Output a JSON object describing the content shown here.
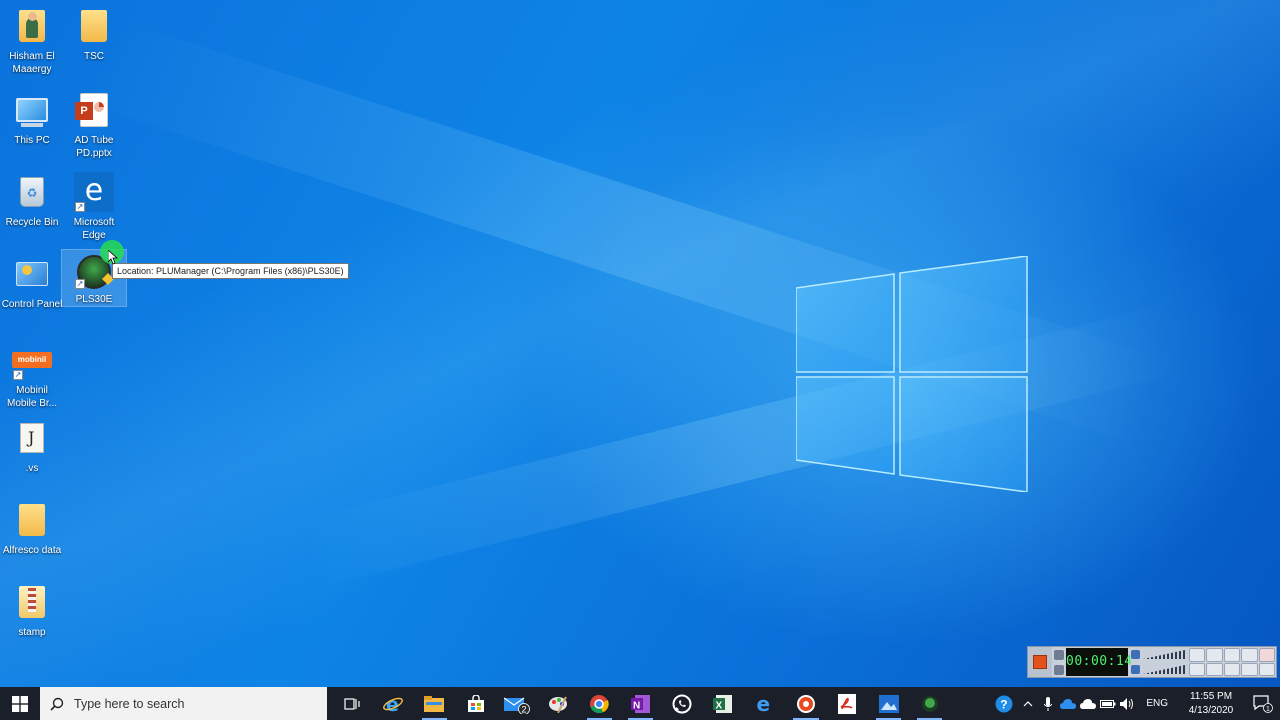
{
  "desktop": {
    "icons": [
      {
        "id": "hisham",
        "label": "Hisham El\nMaaergy",
        "icon": "user-folder-icon"
      },
      {
        "id": "tsc",
        "label": "TSC",
        "icon": "folder-icon"
      },
      {
        "id": "thispc",
        "label": "This PC",
        "icon": "computer-icon"
      },
      {
        "id": "adtube",
        "label": "AD Tube\nPD.pptx",
        "icon": "powerpoint-icon"
      },
      {
        "id": "recycle",
        "label": "Recycle Bin",
        "icon": "recycle-bin-icon"
      },
      {
        "id": "edge",
        "label": "Microsoft\nEdge",
        "icon": "edge-icon"
      },
      {
        "id": "control",
        "label": "Control Panel",
        "icon": "control-panel-icon"
      },
      {
        "id": "pls",
        "label": "PLS30E",
        "icon": "pls-app-icon"
      },
      {
        "id": "mobinil",
        "label": "Mobinil\nMobile Br...",
        "icon": "mobinil-icon"
      },
      {
        "id": "vs",
        "label": ".vs",
        "icon": "document-icon"
      },
      {
        "id": "alfresco",
        "label": "Alfresco data",
        "icon": "folder-icon"
      },
      {
        "id": "stamp",
        "label": "stamp",
        "icon": "archive-folder-icon"
      }
    ],
    "mobinil_badge": "mobinil",
    "tooltip": "Location: PLUManager (C:\\Program Files (x86)\\PLS30E)"
  },
  "recorder": {
    "time": "00:00:14"
  },
  "taskbar": {
    "search_placeholder": "Type here to search",
    "apps": [
      {
        "name": "task-view-icon"
      },
      {
        "name": "internet-explorer-icon"
      },
      {
        "name": "file-explorer-icon"
      },
      {
        "name": "store-icon"
      },
      {
        "name": "mail-icon",
        "badge": "2"
      },
      {
        "name": "paint-icon"
      },
      {
        "name": "chrome-icon"
      },
      {
        "name": "onenote-icon"
      },
      {
        "name": "whatsapp-icon"
      },
      {
        "name": "excel-icon"
      },
      {
        "name": "edge-icon"
      },
      {
        "name": "recorder-icon"
      },
      {
        "name": "acrobat-icon"
      },
      {
        "name": "photos-icon"
      },
      {
        "name": "pls-app-icon"
      }
    ],
    "tray": {
      "language": "ENG",
      "time": "11:55 PM",
      "date": "4/13/2020",
      "notification_count": "1"
    }
  },
  "colors": {
    "taskbar": "#1b1f2a",
    "accent": "#0c73dc"
  }
}
